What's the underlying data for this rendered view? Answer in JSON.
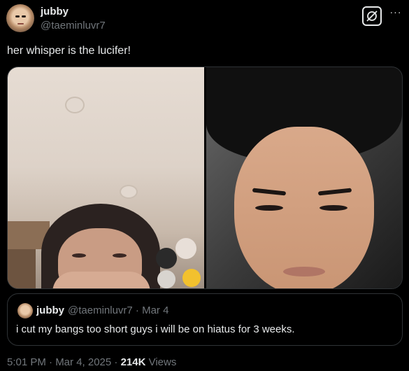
{
  "author": {
    "display_name": "jubby",
    "handle": "@taeminluvr7"
  },
  "header": {
    "grok_icon": "grok-icon",
    "more_icon": "more-icon",
    "more_label": "···"
  },
  "tweet": {
    "text": "her whisper is the lucifer!"
  },
  "media": {
    "images": [
      "woman-selfie-photo",
      "man-portrait-photo"
    ]
  },
  "quoted": {
    "display_name": "jubby",
    "meta": "@taeminluvr7 · Mar 4",
    "text": "i cut my bangs too short guys i will be on hiatus for 3 weeks."
  },
  "footer": {
    "timestamp": "5:01 PM · Mar 4, 2025",
    "separator": " · ",
    "views_count": "214K",
    "views_label": " Views"
  },
  "colors": {
    "background": "#000000",
    "text_primary": "#e7e9ea",
    "text_secondary": "#71767b",
    "border": "#2f3336"
  }
}
